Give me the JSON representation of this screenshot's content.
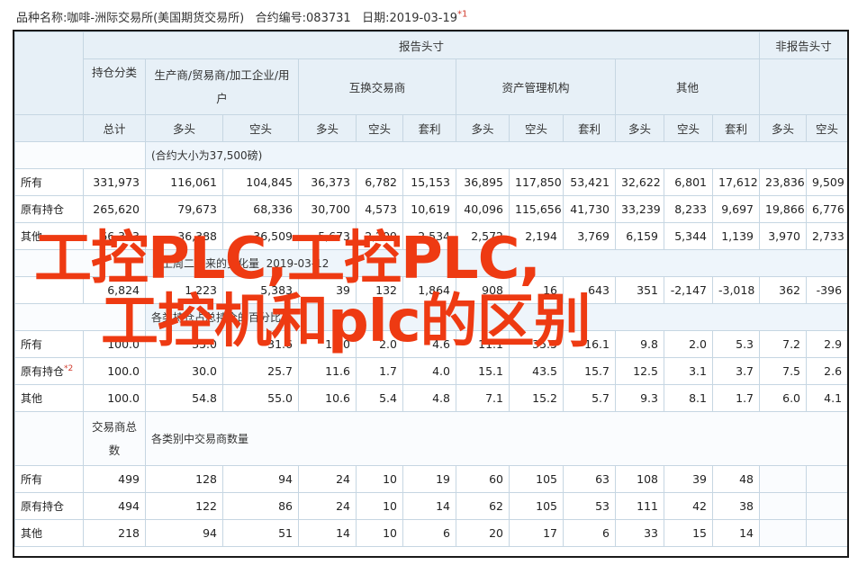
{
  "info": {
    "product_label": "品种名称:",
    "product": "咖啡-洲际交易所(美国期货交易所)",
    "contract_label": "合约编号:",
    "contract": "083731",
    "date_label": "日期:",
    "date": "2019-03-19",
    "footnote": "*1"
  },
  "header": {
    "reportable": "报告头寸",
    "nonreportable": "非报告头寸",
    "position_class": "持仓分类",
    "producer": "生产商/贸易商/加工企业/用户",
    "swap": "互换交易商",
    "managed": "资产管理机构",
    "other": "其他",
    "total": "总计",
    "long": "多头",
    "short": "空头",
    "spread": "套利"
  },
  "sections": {
    "contract_size": "(合约大小为37,500磅)",
    "change": "自上周二以来的变化量",
    "change_date": "2019-03-12",
    "pct": "各类持仓占总持仓的百分比",
    "trader_count_header": "交易商总数",
    "trader_count": "各类别中交易商数量"
  },
  "rows_positions": [
    {
      "label": "所有",
      "cells": [
        "331,973",
        "116,061",
        "104,845",
        "36,373",
        "6,782",
        "15,153",
        "36,895",
        "117,850",
        "53,421",
        "32,622",
        "6,801",
        "17,612",
        "23,836",
        "9,509"
      ]
    },
    {
      "label": "原有持仓",
      "cells": [
        "265,620",
        "79,673",
        "68,336",
        "30,700",
        "4,573",
        "10,619",
        "40,096",
        "115,656",
        "41,730",
        "33,239",
        "8,233",
        "9,697",
        "19,866",
        "6,776"
      ]
    },
    {
      "label": "其他",
      "cells": [
        "66,353",
        "36,388",
        "36,509",
        "5,673",
        "2,209",
        "2,534",
        "2,572",
        "2,194",
        "3,769",
        "6,159",
        "5,344",
        "1,139",
        "3,970",
        "2,733"
      ]
    }
  ],
  "rows_change": [
    {
      "label": "",
      "cells": [
        "6,824",
        "1,223",
        "5,383",
        "39",
        "132",
        "1,864",
        "908",
        "16",
        "643",
        "351",
        "-2,147",
        "-3,018",
        "362",
        "-396"
      ]
    }
  ],
  "rows_pct": [
    {
      "label": "所有",
      "footnote": "",
      "cells": [
        "100.0",
        "35.0",
        "31.6",
        "11.0",
        "2.0",
        "4.6",
        "11.1",
        "35.5",
        "16.1",
        "9.8",
        "2.0",
        "5.3",
        "7.2",
        "2.9"
      ]
    },
    {
      "label": "原有持仓",
      "footnote": "*2",
      "cells": [
        "100.0",
        "30.0",
        "25.7",
        "11.6",
        "1.7",
        "4.0",
        "15.1",
        "43.5",
        "15.7",
        "12.5",
        "3.1",
        "3.7",
        "7.5",
        "2.6"
      ]
    },
    {
      "label": "其他",
      "footnote": "",
      "cells": [
        "100.0",
        "54.8",
        "55.0",
        "10.6",
        "5.4",
        "4.8",
        "7.1",
        "15.2",
        "5.7",
        "9.3",
        "8.1",
        "1.7",
        "6.0",
        "4.1"
      ]
    }
  ],
  "rows_traders": [
    {
      "label": "所有",
      "cells": [
        "499",
        "128",
        "94",
        "24",
        "10",
        "19",
        "60",
        "105",
        "63",
        "108",
        "39",
        "48",
        "",
        ""
      ]
    },
    {
      "label": "原有持仓",
      "cells": [
        "494",
        "122",
        "86",
        "24",
        "10",
        "14",
        "62",
        "105",
        "53",
        "111",
        "42",
        "38",
        "",
        ""
      ]
    },
    {
      "label": "其他",
      "cells": [
        "218",
        "94",
        "51",
        "14",
        "10",
        "6",
        "20",
        "17",
        "6",
        "33",
        "15",
        "14",
        "",
        ""
      ]
    }
  ],
  "overlay": {
    "line1": "工控PLC,工控PLC,",
    "line2": "工控机和plc的区别"
  }
}
